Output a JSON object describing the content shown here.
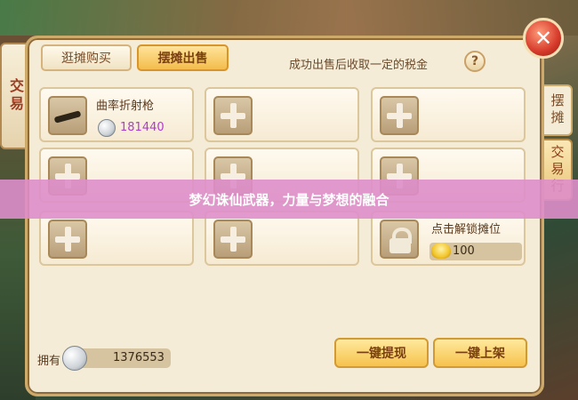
{
  "left_tag": {
    "label": "交易"
  },
  "tabs": {
    "browse": "逛摊购买",
    "sell": "摆摊出售"
  },
  "tax_note": "成功出售后收取一定的税金",
  "help": "?",
  "close": "✕",
  "right_tabs": {
    "stall": "摆摊",
    "trade": "交易行"
  },
  "item": {
    "name": "曲率折射枪",
    "price": "181440"
  },
  "locked_slot": {
    "label": "点击解锁摊位",
    "cost": "100"
  },
  "currency": {
    "own_label": "拥有",
    "own_value": "1376553"
  },
  "buttons": {
    "withdraw": "一键提现",
    "list": "一键上架"
  },
  "banner": "梦幻诛仙武器，力量与梦想的融合"
}
